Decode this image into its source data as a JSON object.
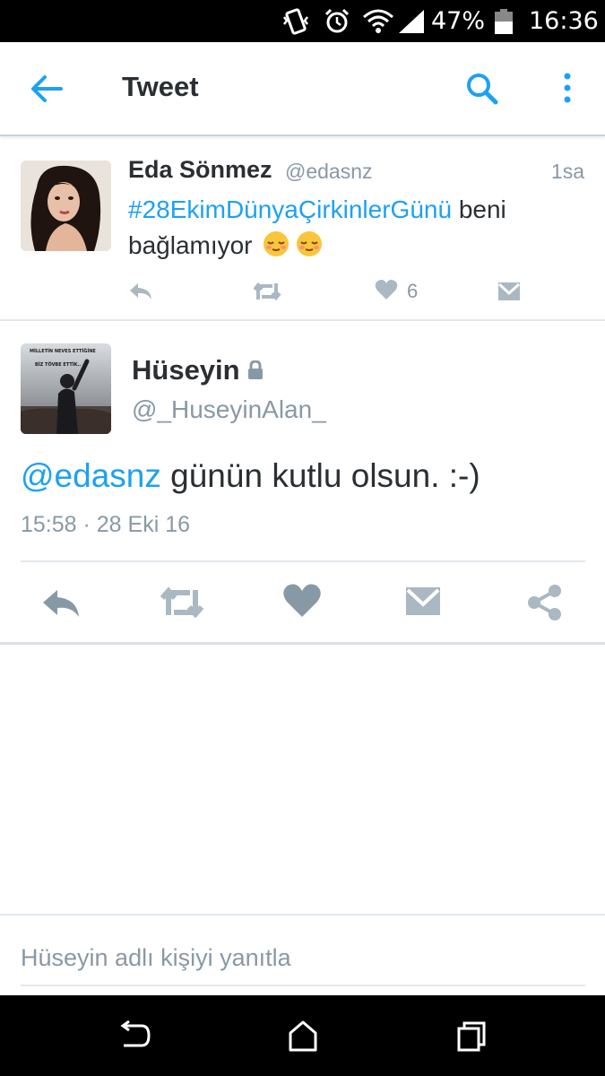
{
  "status_bar": {
    "battery": "47%",
    "time": "16:36"
  },
  "header": {
    "title": "Tweet"
  },
  "parent_tweet": {
    "name": "Eda Sönmez",
    "handle": "@edasnz",
    "time": "1sa",
    "hashtag": "#28EkimDünyaÇirkinlerGünü",
    "text": " beni bağlamıyor ",
    "like_count": "6"
  },
  "main_tweet": {
    "name": "Hüseyin",
    "handle": "@_HuseyinAlan_",
    "mention": "@edasnz",
    "text": " günün kutlu olsun. :-)",
    "timestamp": "15:58 · 28 Eki 16",
    "avatar_caption_1": "MİLLETİN NEVES ETTİĞİNE",
    "avatar_caption_2": "BİZ TÖVBE ETTİK.."
  },
  "reply": {
    "placeholder": "Hüseyin adlı kişiyi yanıtla"
  },
  "colors": {
    "accent": "#1da1f2",
    "muted": "#8899a6",
    "action": "#aab8c2",
    "text": "#292f33"
  }
}
